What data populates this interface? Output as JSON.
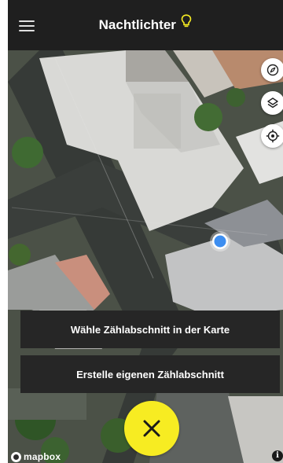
{
  "header": {
    "title": "Nachtlichter",
    "menu_icon": "hamburger-menu-icon",
    "title_icon": "lightbulb-icon"
  },
  "map": {
    "controls": [
      {
        "name": "compass-button",
        "icon": "compass-icon"
      },
      {
        "name": "layers-button",
        "icon": "layers-icon"
      },
      {
        "name": "locate-button",
        "icon": "locate-icon"
      }
    ],
    "attribution_logo": "mapbox",
    "info_label": "i"
  },
  "actions": {
    "choose_label": "Wähle Zählabschnitt in der Karte",
    "create_label": "Erstelle eigenen Zählabschnitt"
  },
  "fab": {
    "icon": "close-icon"
  },
  "colors": {
    "header_bg": "#1f1f1f",
    "accent_yellow": "#f7ec22",
    "location_dot": "#3d8ef0",
    "button_bg": "#262626"
  }
}
